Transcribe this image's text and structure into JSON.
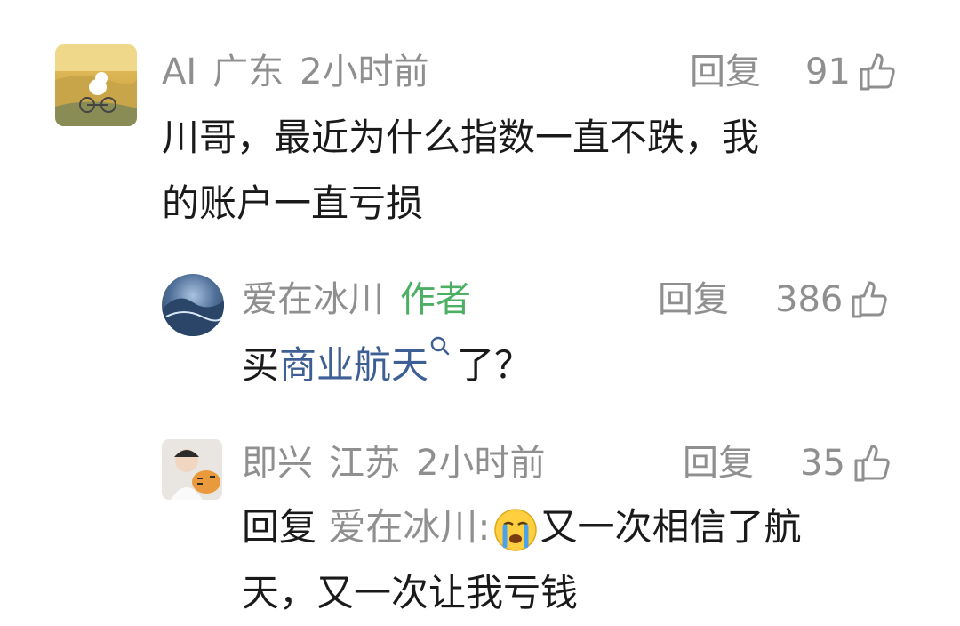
{
  "comments": [
    {
      "username": "AI",
      "location": "广东",
      "time": "2小时前",
      "reply_label": "回复",
      "likes": "91",
      "text_lines": [
        "川哥，最近为什么指数一直不跌，我",
        "的账户一直亏损"
      ]
    },
    {
      "username": "爱在冰川",
      "badge": "作者",
      "reply_label": "回复",
      "likes": "386",
      "text_before": "买",
      "topic_link": "商业航天",
      "text_after": "了？"
    },
    {
      "username": "即兴",
      "location": "江苏",
      "time": "2小时前",
      "reply_label": "回复",
      "likes": "35",
      "reply_prefix": "回复",
      "reply_to": "爱在冰川:",
      "text_line1": "又一次相信了航",
      "text_line2": "天，又一次让我亏钱"
    }
  ],
  "icons": {
    "like": "thumbs-up-icon",
    "search": "search-icon",
    "emoji": "crying-face-icon"
  },
  "colors": {
    "meta_gray": "#8f8f8f",
    "author_green": "#4caf63",
    "topic_blue": "#3d5f94"
  }
}
